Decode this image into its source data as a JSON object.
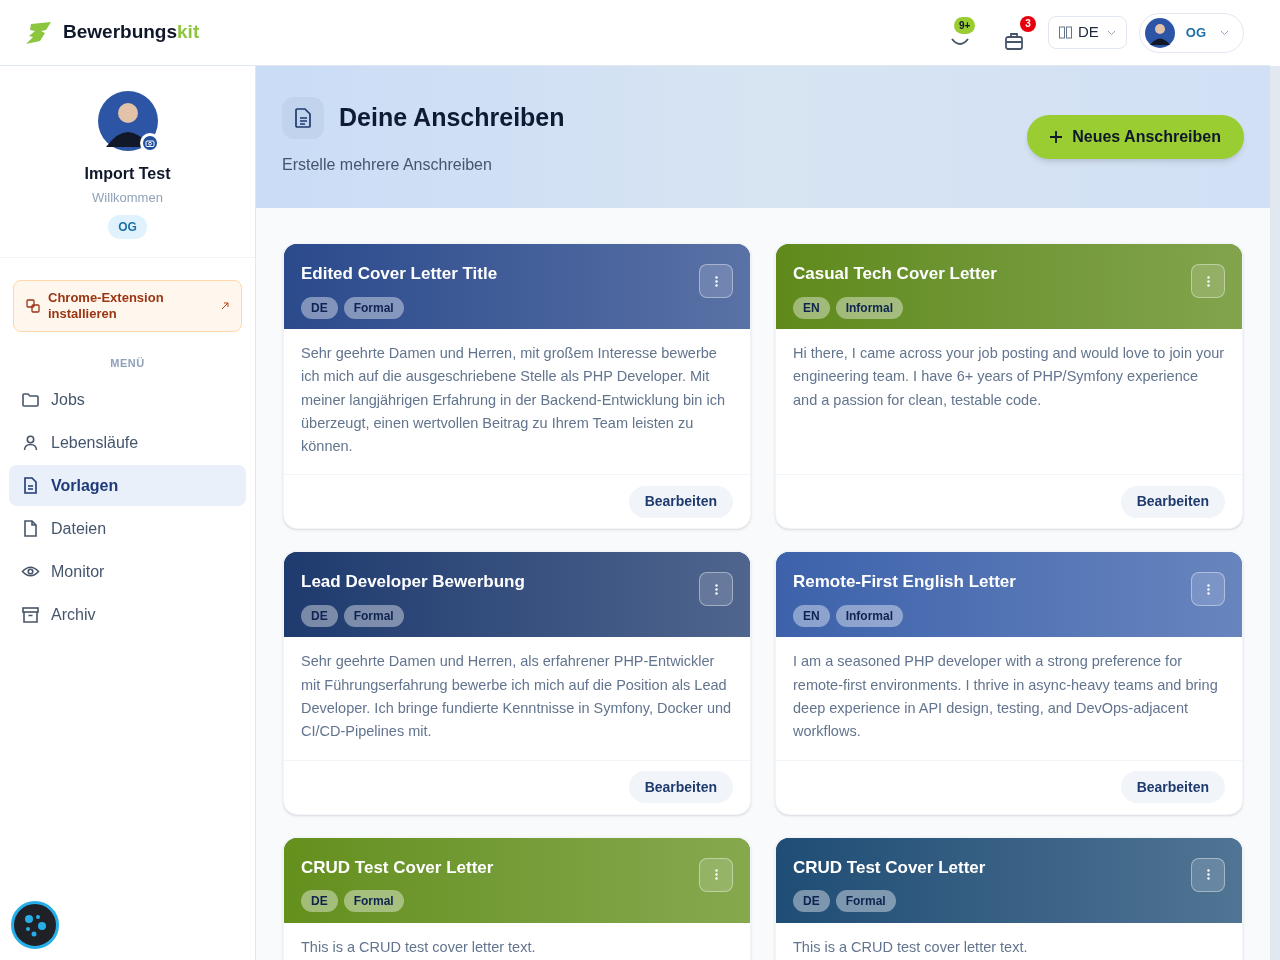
{
  "brand": {
    "name": "Bewerbungs",
    "accent": "kit"
  },
  "header": {
    "points_badge": "9+",
    "notifications_badge": "3",
    "language": "DE",
    "user_initials": "OG"
  },
  "profile": {
    "name": "Import Test",
    "subtitle": "Willkommen",
    "initials": "OG"
  },
  "extension_button": "Chrome-Extension installieren",
  "menu": {
    "title": "MENÜ",
    "items": [
      {
        "label": "Jobs",
        "selected": false
      },
      {
        "label": "Lebensläufe",
        "selected": false
      },
      {
        "label": "Vorlagen",
        "selected": true
      },
      {
        "label": "Dateien",
        "selected": false
      },
      {
        "label": "Monitor",
        "selected": false
      },
      {
        "label": "Archiv",
        "selected": false
      }
    ]
  },
  "hero": {
    "title": "Deine Anschreiben",
    "subtitle": "Erstelle mehrere Anschreiben",
    "action": "Neues Anschreiben"
  },
  "cards": [
    {
      "title": "Edited Cover Letter Title",
      "color": "#2b4a8c",
      "tags": [
        "DE",
        "Formal"
      ],
      "text": "Sehr geehrte Damen und Herren, mit großem Interesse bewerbe ich mich auf die ausgeschriebene Stelle als PHP Developer. Mit meiner langjährigen Erfahrung in der Backend-Entwicklung bin ich überzeugt, einen wertvollen Beitrag zu Ihrem Team leisten zu können.",
      "button": "Bearbeiten"
    },
    {
      "title": "Casual Tech Cover Letter",
      "color": "#5f8a1a",
      "tags": [
        "EN",
        "Informal"
      ],
      "text": "Hi there, I came across your job posting and would love to join your engineering team. I have 6+ years of PHP/Symfony experience and a passion for clean, testable code.",
      "button": "Bearbeiten"
    },
    {
      "title": "Lead Developer Bewerbung",
      "color": "#1e3a6e",
      "tags": [
        "DE",
        "Formal"
      ],
      "text": "Sehr geehrte Damen und Herren, als erfahrener PHP-Entwickler mit Führungserfahrung bewerbe ich mich auf die Position als Lead Developer. Ich bringe fundierte Kenntnisse in Symfony, Docker und CI/CD-Pipelines mit.",
      "button": "Bearbeiten"
    },
    {
      "title": "Remote-First English Letter",
      "color": "#3d62ab",
      "tags": [
        "EN",
        "Informal"
      ],
      "text": "I am a seasoned PHP developer with a strong preference for remote-first environments. I thrive in async-heavy teams and bring deep experience in API design, testing, and DevOps-adjacent workflows.",
      "button": "Bearbeiten"
    },
    {
      "title": "CRUD Test Cover Letter",
      "color": "#64901c",
      "tags": [
        "DE",
        "Formal"
      ],
      "text": "This is a CRUD test cover letter text."
    },
    {
      "title": "CRUD Test Cover Letter",
      "color": "#1f4d75",
      "tags": [
        "DE",
        "Formal"
      ],
      "text": "This is a CRUD test cover letter text."
    }
  ]
}
